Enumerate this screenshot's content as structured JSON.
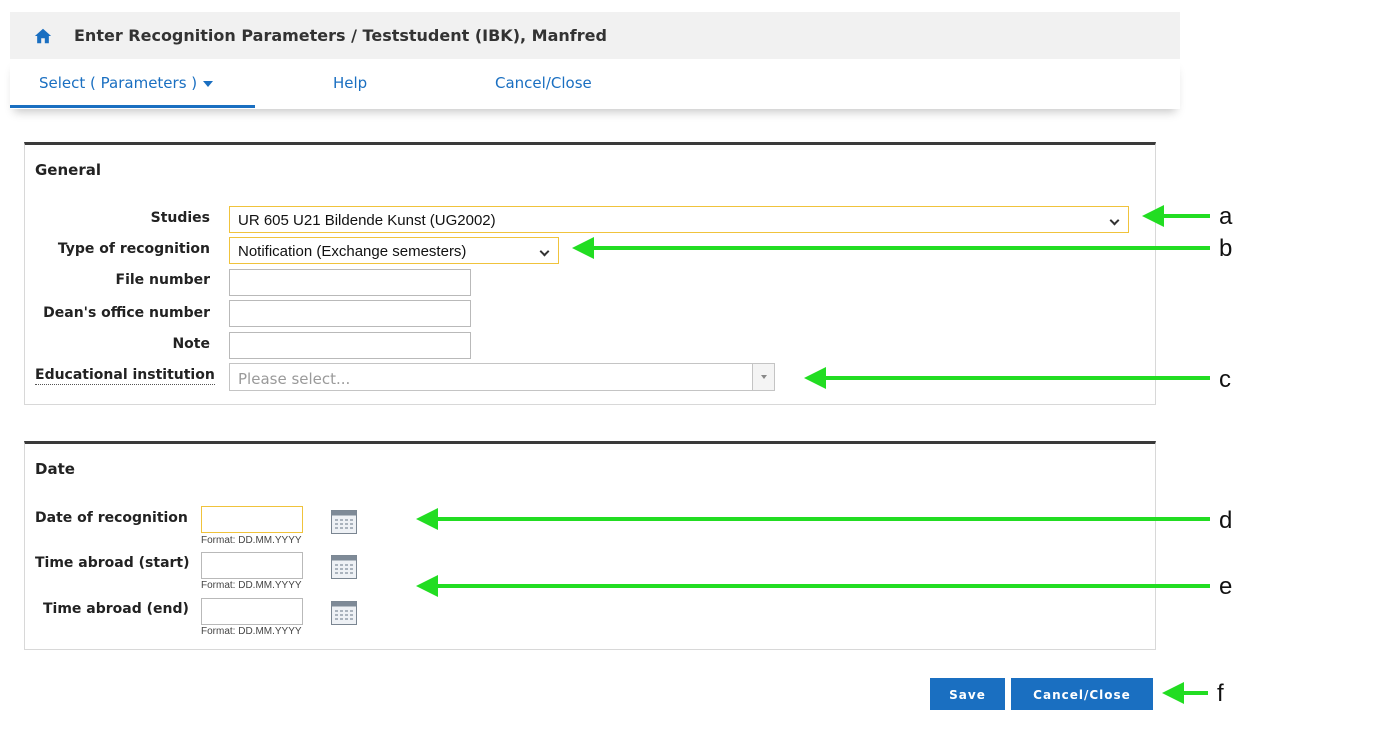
{
  "header": {
    "title": "Enter Recognition Parameters  / Teststudent (IBK), Manfred",
    "home_icon": "home-icon"
  },
  "menu": {
    "items": [
      {
        "label": "Select ( Parameters )"
      },
      {
        "label": "Help"
      },
      {
        "label": "Cancel/Close"
      }
    ]
  },
  "general": {
    "title": "General",
    "studies": {
      "label": "Studies",
      "value": "UR 605 U21 Bildende Kunst (UG2002)"
    },
    "type_of_recognition": {
      "label": "Type of recognition",
      "value": "Notification (Exchange semesters)"
    },
    "file_number": {
      "label": "File number",
      "value": ""
    },
    "deans_office_number": {
      "label": "Dean's office number",
      "value": ""
    },
    "note": {
      "label": "Note",
      "value": ""
    },
    "educational_institution": {
      "label": "Educational institution",
      "placeholder": "Please select..."
    }
  },
  "date": {
    "title": "Date",
    "date_of_recognition": {
      "label": "Date of recognition",
      "format": "Format: DD.MM.YYYY",
      "value": ""
    },
    "time_abroad_start": {
      "label": "Time abroad (start)",
      "format": "Format: DD.MM.YYYY",
      "value": ""
    },
    "time_abroad_end": {
      "label": "Time abroad (end)",
      "format": "Format: DD.MM.YYYY",
      "value": ""
    }
  },
  "buttons": {
    "save": "Save",
    "cancel_close": "Cancel/Close"
  },
  "annotations": [
    "a",
    "b",
    "c",
    "d",
    "e",
    "f"
  ],
  "colors": {
    "accent": "#1a6fc1",
    "highlight_border": "#f0c33c",
    "annotation_arrow": "#22dd22"
  }
}
